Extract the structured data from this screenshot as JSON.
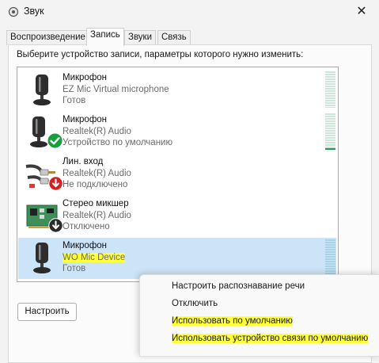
{
  "window": {
    "title": "Звук",
    "icon": "speaker-icon",
    "close_glyph": "✕"
  },
  "tabs": [
    {
      "label": "Воспроизведение",
      "active": false
    },
    {
      "label": "Запись",
      "active": true
    },
    {
      "label": "Звуки",
      "active": false
    },
    {
      "label": "Связь",
      "active": false
    }
  ],
  "instruction": "Выберите устройство записи, параметры которого нужно изменить:",
  "devices": [
    {
      "name": "Микрофон",
      "description": "EZ Mic Virtual microphone",
      "status": "Готов",
      "icon": "microphone-icon",
      "badge": null,
      "selected": false,
      "level": 0
    },
    {
      "name": "Микрофон",
      "description": "Realtek(R) Audio",
      "status": "Устройство по умолчанию",
      "icon": "microphone-icon",
      "badge": "green-check-icon",
      "selected": false,
      "level": 0.05
    },
    {
      "name": "Лин. вход",
      "description": "Realtek(R) Audio",
      "status": "Не подключено",
      "icon": "line-in-cable-icon",
      "badge": "red-down-arrow-icon",
      "selected": false,
      "level": 0
    },
    {
      "name": "Стерео микшер",
      "description": "Realtek(R) Audio",
      "status": "Отключено",
      "icon": "sound-card-icon",
      "badge": "black-down-arrow-icon",
      "selected": false,
      "level": 0
    },
    {
      "name": "Микрофон",
      "description": "WO Mic Device",
      "status": "Готов",
      "icon": "microphone-icon",
      "badge": null,
      "selected": true,
      "level": 0
    }
  ],
  "buttons": {
    "configure": "Настроить"
  },
  "context_menu": {
    "items": [
      {
        "label": "Настроить распознавание речи",
        "highlighted": false
      },
      {
        "label": "Отключить",
        "highlighted": false
      },
      {
        "label": "Использовать по умолчанию",
        "highlighted": true
      },
      {
        "label": "Использовать устройство связи по умолчанию",
        "highlighted": true
      }
    ]
  },
  "colors": {
    "selection": "#cce4f7",
    "highlight": "#ffff3a",
    "meter_active": "#1f9e4a",
    "check_badge": "#15a03c",
    "red_badge": "#d42020"
  }
}
